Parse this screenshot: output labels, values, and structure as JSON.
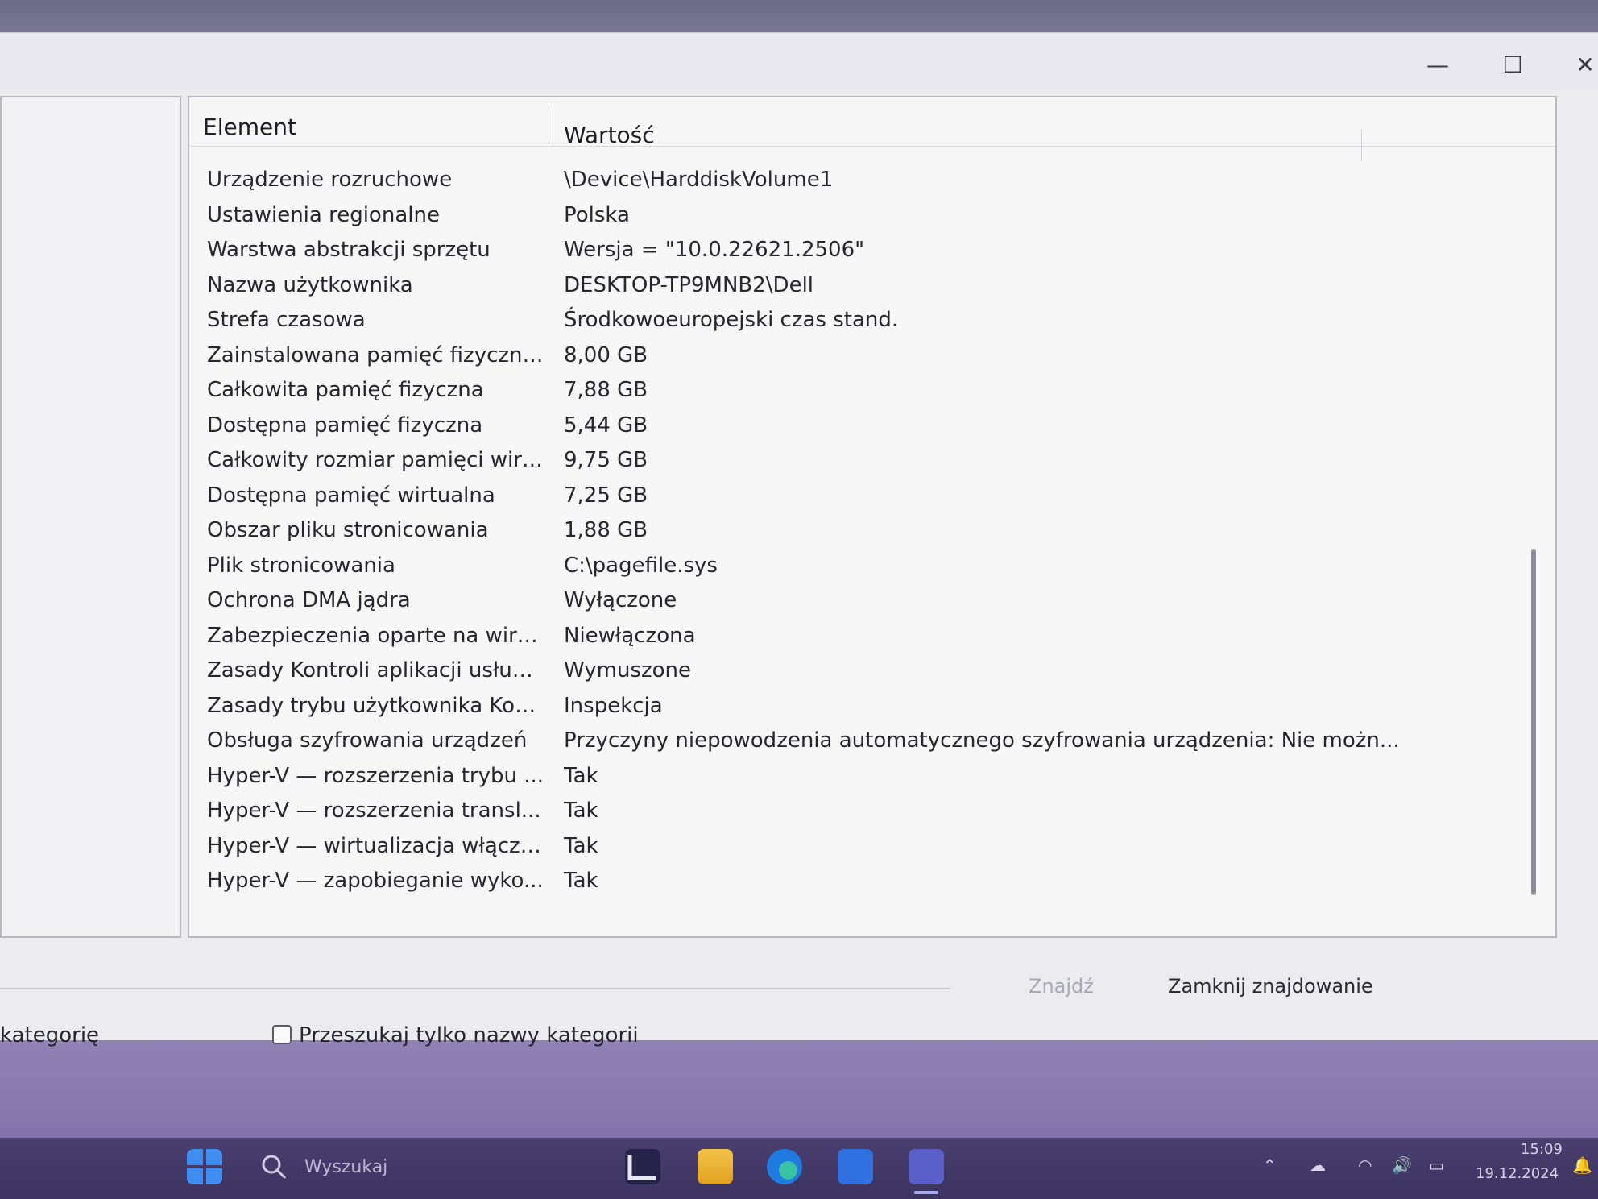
{
  "window": {
    "minimize": "—",
    "maximize": "☐",
    "close": "✕"
  },
  "list": {
    "column_element": "Element",
    "column_value": "Wartość",
    "rows": [
      {
        "element": "Urządzenie rozruchowe",
        "value": "\\Device\\HarddiskVolume1"
      },
      {
        "element": "Ustawienia regionalne",
        "value": "Polska"
      },
      {
        "element": "Warstwa abstrakcji sprzętu",
        "value": "Wersja = \"10.0.22621.2506\""
      },
      {
        "element": "Nazwa użytkownika",
        "value": "DESKTOP-TP9MNB2\\Dell"
      },
      {
        "element": "Strefa czasowa",
        "value": "Środkowoeuropejski czas stand."
      },
      {
        "element": "Zainstalowana pamięć fizyczna ...",
        "value": "8,00 GB"
      },
      {
        "element": "Całkowita pamięć fizyczna",
        "value": "7,88 GB"
      },
      {
        "element": "Dostępna pamięć fizyczna",
        "value": "5,44 GB"
      },
      {
        "element": "Całkowity rozmiar pamięci wirt...",
        "value": "9,75 GB"
      },
      {
        "element": "Dostępna pamięć wirtualna",
        "value": "7,25 GB"
      },
      {
        "element": "Obszar pliku stronicowania",
        "value": "1,88 GB"
      },
      {
        "element": "Plik stronicowania",
        "value": "C:\\pagefile.sys"
      },
      {
        "element": "Ochrona DMA jądra",
        "value": "Wyłączone"
      },
      {
        "element": "Zabezpieczenia oparte na wirtu...",
        "value": "Niewłączona"
      },
      {
        "element": "Zasady Kontroli aplikacji usługi ...",
        "value": "Wymuszone"
      },
      {
        "element": "Zasady trybu użytkownika Kont...",
        "value": "Inspekcja"
      },
      {
        "element": "Obsługa szyfrowania urządzeń",
        "value": "Przyczyny niepowodzenia automatycznego szyfrowania urządzenia: Nie możn..."
      },
      {
        "element": "Hyper-V — rozszerzenia trybu ...",
        "value": "Tak"
      },
      {
        "element": "Hyper-V — rozszerzenia transl...",
        "value": "Tak"
      },
      {
        "element": "Hyper-V — wirtualizacja włączo...",
        "value": "Tak"
      },
      {
        "element": "Hyper-V — zapobieganie wyko...",
        "value": "Tak"
      }
    ]
  },
  "find": {
    "find_button": "Znajdź",
    "close_find_button": "Zamknij znajdowanie",
    "category_label_partial": "kategorię",
    "search_only_categories": "Przeszukaj tylko nazwy kategorii"
  },
  "taskbar": {
    "search_placeholder": "Wyszukaj",
    "time": "15:09",
    "date": "19.12.2024"
  },
  "colors": {
    "accent": "#1e6fd9",
    "taskbar": "#3c3360"
  }
}
